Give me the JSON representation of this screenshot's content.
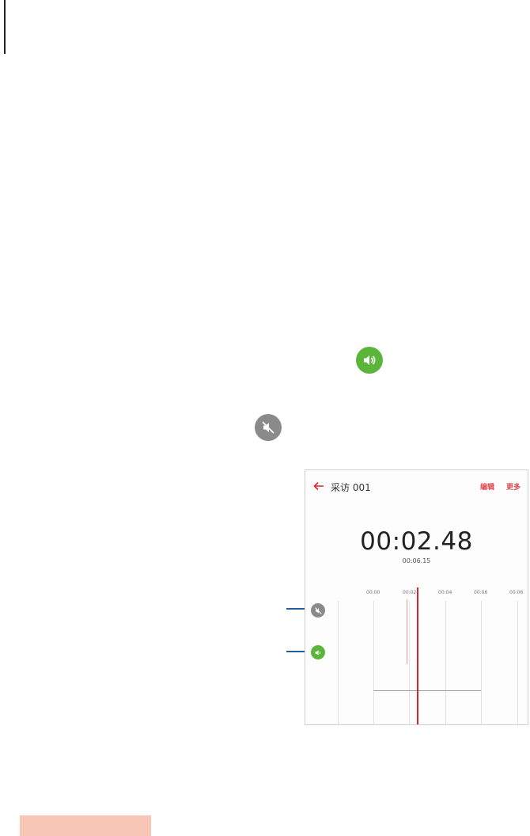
{
  "recording": {
    "title": "采访 001",
    "actions": [
      "编辑",
      "更多"
    ],
    "elapsed": "00:02.48",
    "total": "00:06.15"
  },
  "timeline": {
    "labels": [
      "00:00",
      "00:02",
      "00:04",
      "00:06",
      "00:06"
    ]
  },
  "colors": {
    "accent": "#e0474c",
    "playhead": "#d9262d",
    "speaker_on": "#5bb53a",
    "speaker_muted": "#8a8a8a",
    "callout": "#1f5fa0",
    "section_bar": "#f7c6b5"
  },
  "icons": {
    "legend_on": "speaker-icon",
    "legend_muted": "speaker-muted-icon",
    "back": "back-arrow-icon"
  }
}
